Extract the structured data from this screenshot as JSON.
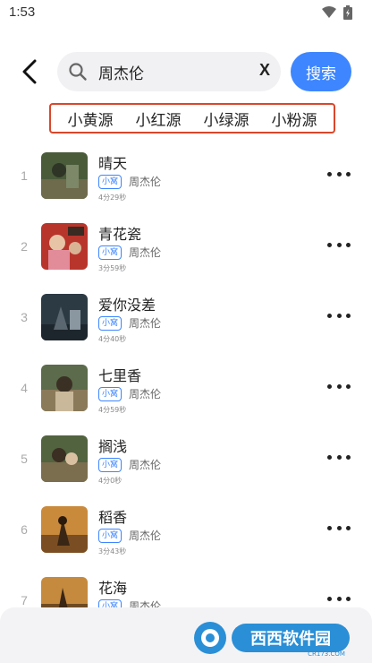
{
  "status_bar": {
    "time": "1:53"
  },
  "search": {
    "query": "周杰伦",
    "clear_label": "X",
    "button_label": "搜索"
  },
  "sources": [
    "小黄源",
    "小红源",
    "小绿源",
    "小粉源"
  ],
  "songs": [
    {
      "index": "1",
      "title": "晴天",
      "badge": "小窝",
      "artist": "周杰伦",
      "duration": "4分29秒"
    },
    {
      "index": "2",
      "title": "青花瓷",
      "badge": "小窝",
      "artist": "周杰伦",
      "duration": "3分59秒"
    },
    {
      "index": "3",
      "title": "爱你没差",
      "badge": "小窝",
      "artist": "周杰伦",
      "duration": "4分40秒"
    },
    {
      "index": "4",
      "title": "七里香",
      "badge": "小窝",
      "artist": "周杰伦",
      "duration": "4分59秒"
    },
    {
      "index": "5",
      "title": "搁浅",
      "badge": "小窝",
      "artist": "周杰伦",
      "duration": "4分0秒"
    },
    {
      "index": "6",
      "title": "稻香",
      "badge": "小窝",
      "artist": "周杰伦",
      "duration": "3分43秒"
    },
    {
      "index": "7",
      "title": "花海",
      "badge": "小窝",
      "artist": "周杰伦",
      "duration": ""
    }
  ],
  "watermark": {
    "brand": "西西软件园",
    "domain": "CR173.COM"
  },
  "colors": {
    "accent": "#3d86ff",
    "source_border": "#d9472b",
    "bottom_panel": "#f3f3f5"
  },
  "icons": {
    "back": "back-arrow-icon",
    "search": "search-icon",
    "more": "more-dots-icon",
    "wifi": "wifi-icon",
    "battery": "battery-icon"
  }
}
